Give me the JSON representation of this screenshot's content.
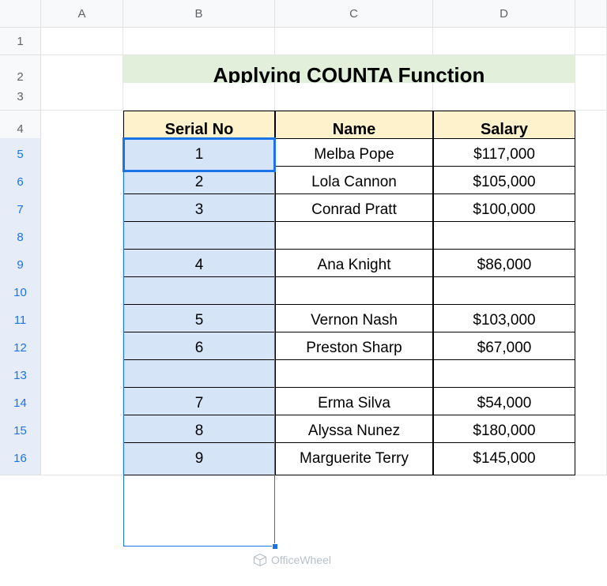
{
  "columns": [
    "A",
    "B",
    "C",
    "D",
    ""
  ],
  "rows": [
    "1",
    "2",
    "3",
    "4",
    "5",
    "6",
    "7",
    "8",
    "9",
    "10",
    "11",
    "12",
    "13",
    "14",
    "15",
    "16"
  ],
  "title": "Applying COUNTA Function",
  "headers": {
    "b": "Serial No",
    "c": "Name",
    "d": "Salary"
  },
  "data": {
    "r5": {
      "serial": "1",
      "name": "Melba Pope",
      "salary": "$117,000"
    },
    "r6": {
      "serial": "2",
      "name": "Lola Cannon",
      "salary": "$105,000"
    },
    "r7": {
      "serial": "3",
      "name": "Conrad Pratt",
      "salary": "$100,000"
    },
    "r8": {
      "serial": "",
      "name": "",
      "salary": ""
    },
    "r9": {
      "serial": "4",
      "name": "Ana Knight",
      "salary": "$86,000"
    },
    "r10": {
      "serial": "",
      "name": "",
      "salary": ""
    },
    "r11": {
      "serial": "5",
      "name": "Vernon Nash",
      "salary": "$103,000"
    },
    "r12": {
      "serial": "6",
      "name": "Preston Sharp",
      "salary": "$67,000"
    },
    "r13": {
      "serial": "",
      "name": "",
      "salary": ""
    },
    "r14": {
      "serial": "7",
      "name": "Erma Silva",
      "salary": "$54,000"
    },
    "r15": {
      "serial": "8",
      "name": "Alyssa Nunez",
      "salary": "$180,000"
    },
    "r16": {
      "serial": "9",
      "name": "Marguerite Terry",
      "salary": "$145,000"
    }
  },
  "watermark": "OfficeWheel"
}
